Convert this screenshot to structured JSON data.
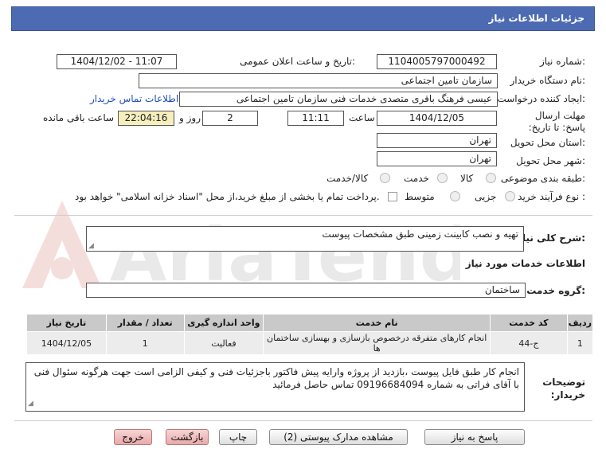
{
  "header": {
    "title": "جزئیات اطلاعات نیاز"
  },
  "fields": {
    "need_number_label": "شماره نیاز:",
    "need_number": "1104005797000492",
    "announce_label": "تاریخ و ساعت اعلان عمومی:",
    "announce_value": "1404/12/02 - 11:07",
    "buyer_org_label": "نام دستگاه خریدار:",
    "buyer_org": "سازمان تامین اجتماعی",
    "requester_label": "ایجاد کننده درخواست:",
    "requester": "عیسی فرهنگ باقری متصدی خدمات فنی سازمان تامین اجتماعی",
    "contact_link": "اطلاعات تماس خریدار",
    "deadline_label": "مهلت ارسال پاسخ: تا تاریخ:",
    "deadline_date": "1404/12/05",
    "time_label": "ساعت",
    "deadline_time": "11:11",
    "days_value": "2",
    "days_label": "روز و",
    "remaining_time": "22:04:16",
    "remaining_label": "ساعت باقی مانده",
    "province_label": "استان محل تحویل:",
    "province": "تهران",
    "city_label": "شهر محل تحویل:",
    "city": "تهران",
    "category_label": "طبقه بندی موضوعی:",
    "category_options": [
      "کالا",
      "خدمت",
      "کالا/خدمت"
    ],
    "process_label": "نوع فرآیند خرید :",
    "process_options": [
      "جزیی",
      "متوسط"
    ],
    "payment_note": "پرداخت تمام یا بخشی از مبلغ خرید،از محل \"اسناد خزانه اسلامی\" خواهد بود."
  },
  "description": {
    "label": "شرح کلی نیاز:",
    "value": "تهیه و نصب کابینت زمینی طبق مشخصات پیوست"
  },
  "services": {
    "section_title": "اطلاعات خدمات مورد نیاز",
    "group_label": "گروه خدمت:",
    "group_value": "ساختمان",
    "table": {
      "headers": [
        "ردیف",
        "کد خدمت",
        "نام خدمت",
        "واحد اندازه گیری",
        "تعداد / مقدار",
        "تاریخ نیاز"
      ],
      "rows": [
        [
          "1",
          "ج-44",
          "انجام کارهای متفرقه درخصوص بازسازی و بهسازی ساختمان ها",
          "فعالیت",
          "1",
          "1404/12/05"
        ]
      ]
    }
  },
  "notes": {
    "label": "توضیحات خریدار:",
    "value": "انجام کار طبق فایل پیوست ،بازدید از پروژه وارایه پیش فاکتور باجزئیات فنی و کیفی الزامی است جهت هرگونه سئوال فنی با آقای فراتی به شماره 09196684094 تماس حاصل فرمائید"
  },
  "buttons": {
    "reply": "پاسخ به نیاز",
    "docs": "مشاهده مدارک پیوستی (2)",
    "print": "چاپ",
    "back": "بازگشت",
    "exit": "خروج"
  },
  "colors": {
    "header": "#4d6bb3",
    "remaining_bg": "#f4efbd",
    "link": "#1b4fbf",
    "button_red": "#e8a9a9"
  },
  "watermark": {
    "text": "AriaTender.neT"
  }
}
